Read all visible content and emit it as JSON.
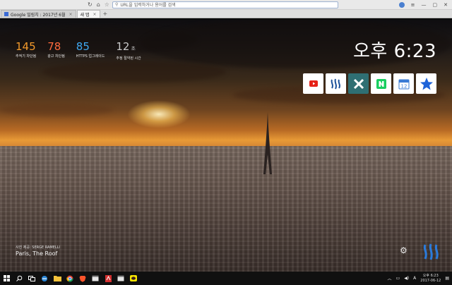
{
  "browser": {
    "url_placeholder": "URL을 입력하거나 용어를 검색",
    "tabs": [
      {
        "title": "Google 밀림치 : 2017년 6월",
        "active": false
      },
      {
        "title": "새 탭",
        "active": true
      }
    ],
    "new_tab_symbol": "+"
  },
  "stats": [
    {
      "value": "145",
      "unit": "",
      "label": "추적기 차단됨",
      "color": "#f39a2b"
    },
    {
      "value": "78",
      "unit": "",
      "label": "광고 차단됨",
      "color": "#ff6a3d"
    },
    {
      "value": "85",
      "unit": "",
      "label": "HTTPS 업그레이드",
      "color": "#3fa8f0"
    },
    {
      "value": "12",
      "unit": "초",
      "label": "추정 절약된 시간",
      "color": "#c9c9c9"
    }
  ],
  "clock": "오후 6:23",
  "tiles": [
    {
      "name": "youtube-icon"
    },
    {
      "name": "steemit-icon"
    },
    {
      "name": "x-app-icon"
    },
    {
      "name": "naver-icon"
    },
    {
      "name": "calendar-icon",
      "text": "12"
    },
    {
      "name": "star-icon"
    }
  ],
  "photo_credit": {
    "by": "사진 제공: SERGE RAMELLI",
    "place": "Paris, The Roof"
  },
  "taskbar": {
    "time": "오후 6:23",
    "date": "2017-06-12",
    "lang": "A"
  }
}
